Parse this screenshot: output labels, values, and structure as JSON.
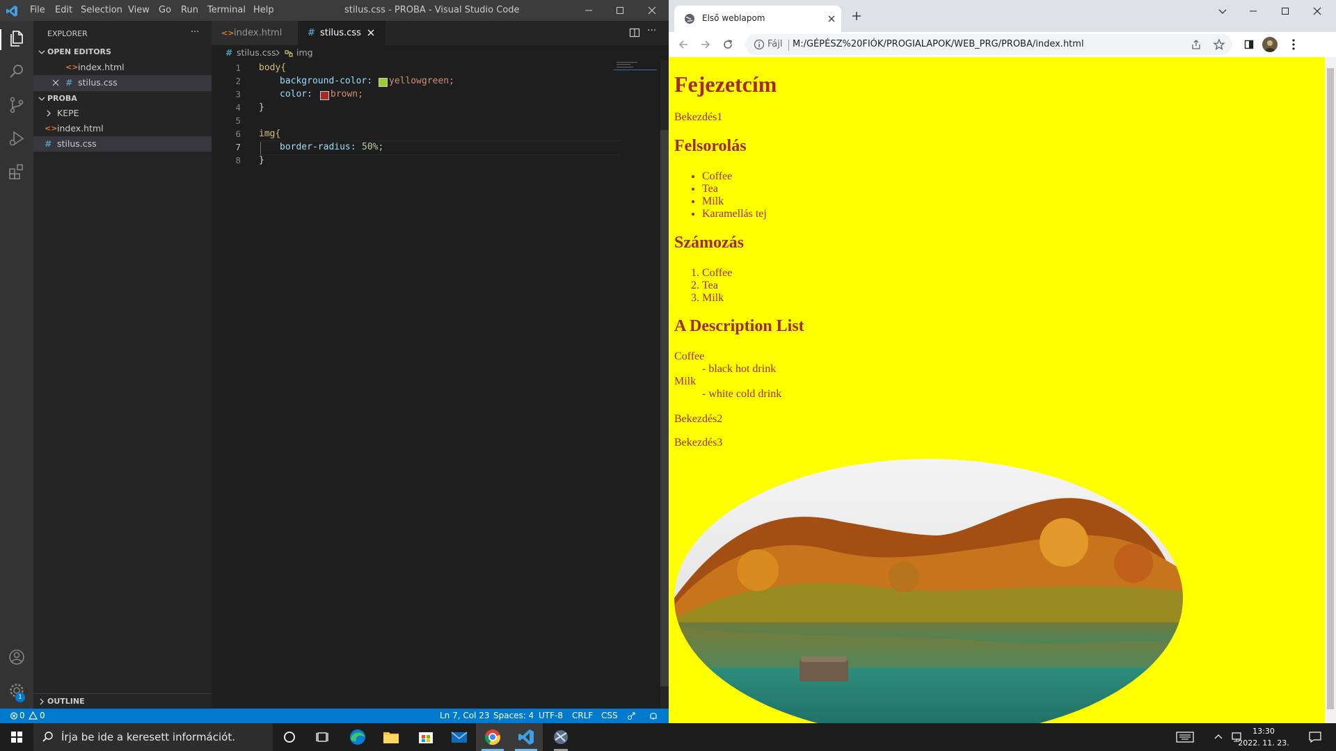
{
  "vscode": {
    "menu": [
      "File",
      "Edit",
      "Selection",
      "View",
      "Go",
      "Run",
      "Terminal",
      "Help"
    ],
    "window_title": "stilus.css - PROBA - Visual Studio Code",
    "explorer": {
      "title": "EXPLORER",
      "more": "···",
      "open_editors_label": "OPEN EDITORS",
      "open_editors": [
        "index.html",
        "stilus.css"
      ],
      "folder_label": "PROBA",
      "folder_items": [
        "KEPE",
        "index.html",
        "stilus.css"
      ],
      "outline_label": "OUTLINE"
    },
    "tabs": [
      "index.html",
      "stilus.css"
    ],
    "breadcrumb": {
      "file": "stilus.css",
      "symbol": "img"
    },
    "line_numbers": [
      "1",
      "2",
      "3",
      "4",
      "5",
      "6",
      "7",
      "8"
    ],
    "code": {
      "l1_selector": "body{",
      "l2_prop": "background-color:",
      "l2_val": "yellowgreen;",
      "l3_prop": "color:",
      "l3_val": "brown;",
      "l4": "}",
      "l6_selector": "img{",
      "l7_prop": "border-radius:",
      "l7_val": "50%;",
      "l8": "}"
    },
    "swatch_colors": {
      "yellowgreen": "#9acd32",
      "brown": "#a52a2a"
    },
    "status": {
      "errors": "0",
      "warnings": "0",
      "position": "Ln 7, Col 23",
      "spaces": "Spaces: 4",
      "encoding": "UTF-8",
      "eol": "CRLF",
      "language": "CSS",
      "badge": "1"
    },
    "accent": "#007acc"
  },
  "chrome": {
    "tab_title": "Első weblapom",
    "file_label": "Fájl",
    "url": "M:/GÉPÉSZ%20FIÓK/PROGIALAPOK/WEB_PRG/PROBA/index.html"
  },
  "page": {
    "h1": "Fejezetcím",
    "p1": "Bekezdés1",
    "h2_list": "Felsorolás",
    "ul": [
      "Coffee",
      "Tea",
      "Milk",
      "Karamellás tej"
    ],
    "h2_num": "Számozás",
    "ol": [
      "Coffee",
      "Tea",
      "Milk"
    ],
    "h2_desc": "A Description List",
    "dl": [
      {
        "term": "Coffee",
        "desc": "- black hot drink"
      },
      {
        "term": "Milk",
        "desc": "- white cold drink"
      }
    ],
    "p2": "Bekezdés2",
    "p3": "Bekezdés3",
    "page_bg": "#ffff00",
    "text_color": "#a52a2a"
  },
  "taskbar": {
    "search_placeholder": "Írja be ide a keresett információt.",
    "time": "13:30",
    "date": "2022. 11. 23."
  }
}
